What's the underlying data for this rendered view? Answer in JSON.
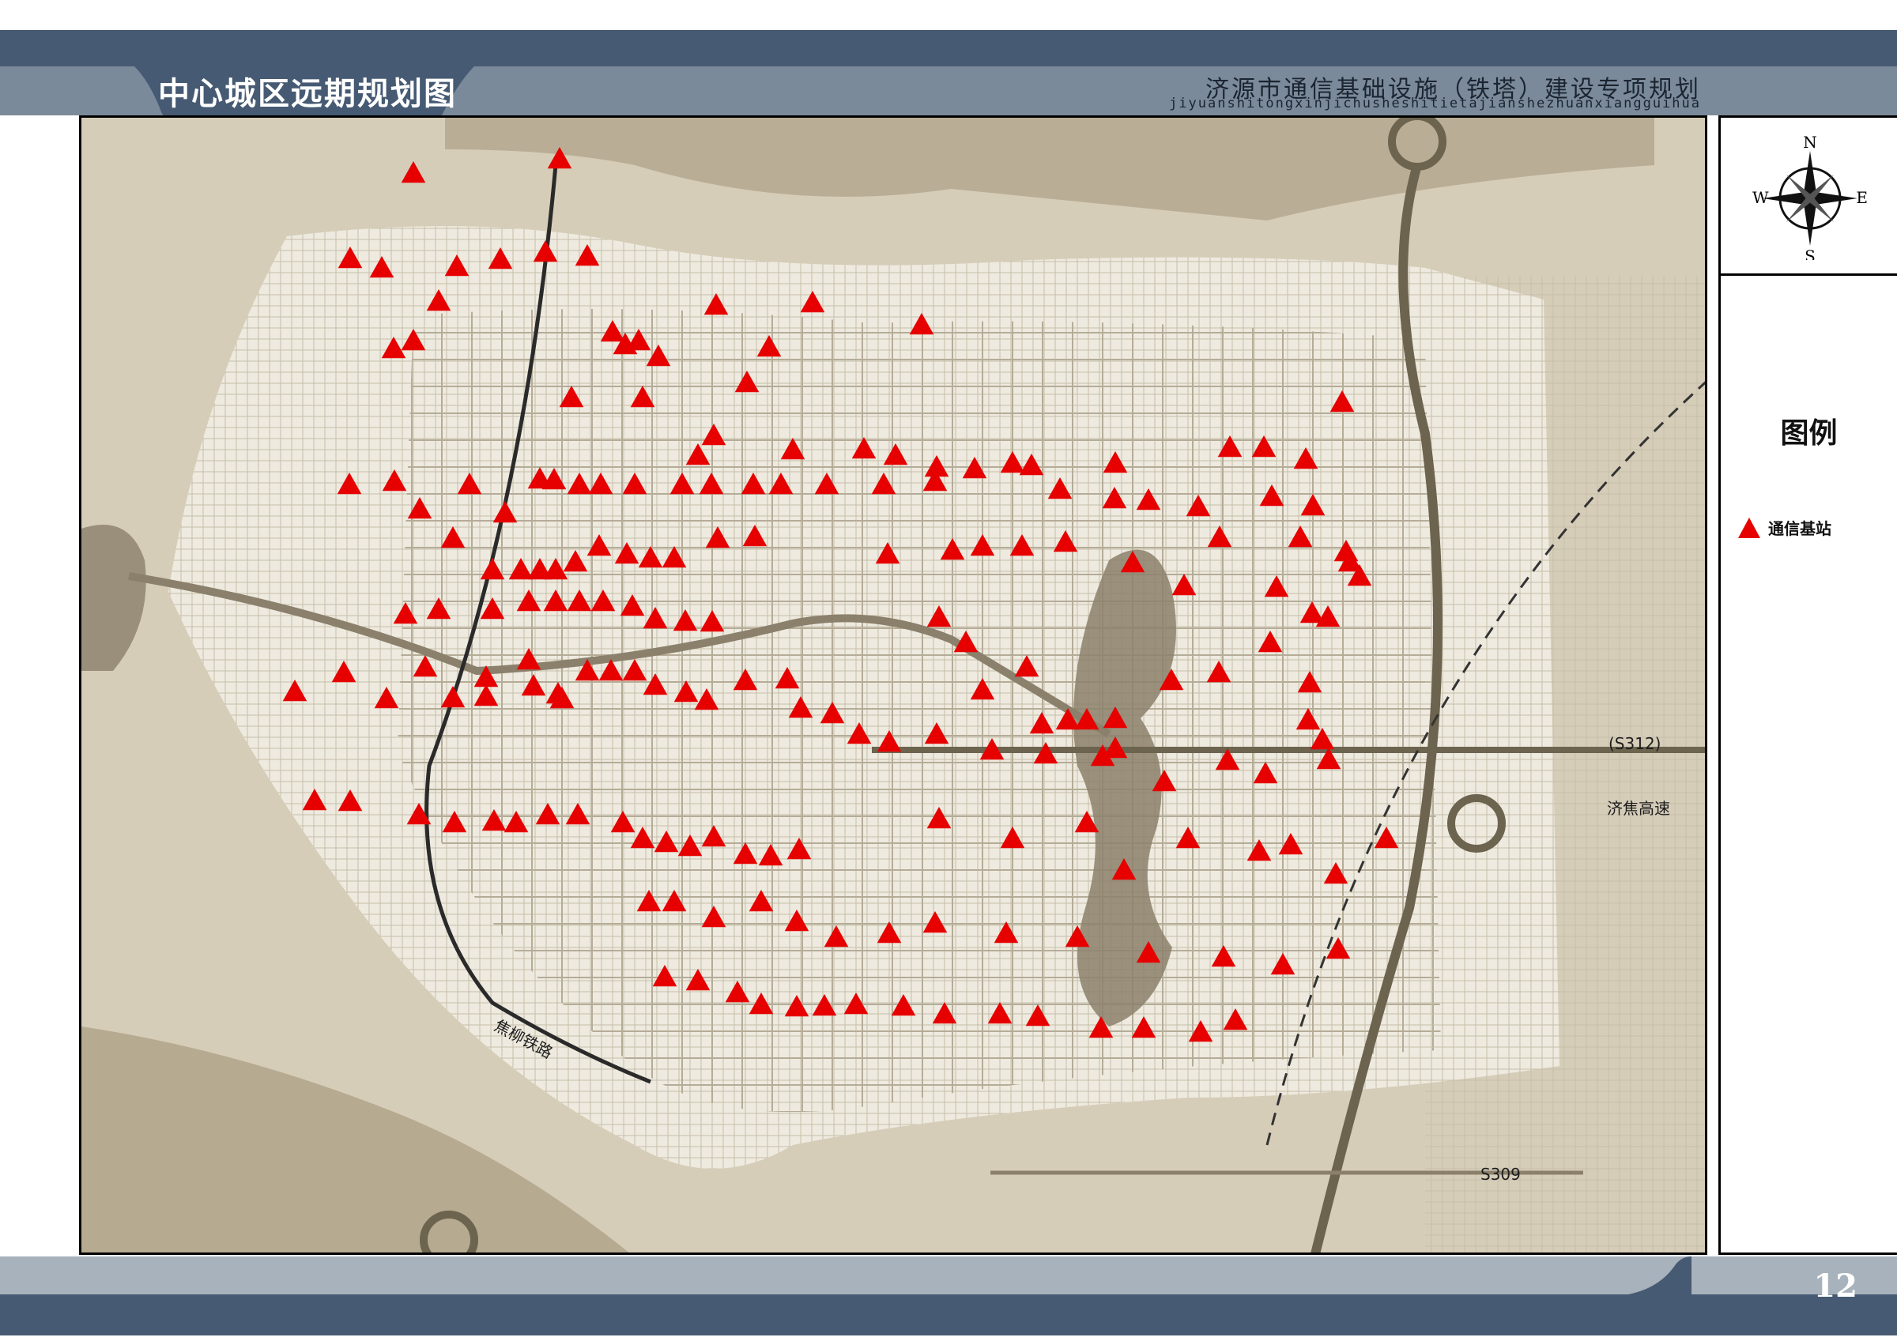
{
  "header": {
    "title": "中心城区远期规划图",
    "subtitle_cn": "济源市通信基础设施（铁塔）建设专项规划",
    "subtitle_pinyin": "jiyuanshitongxinjichusheshitietajianshezhuanxiangguihua"
  },
  "compass": {
    "n": "N",
    "s": "S",
    "e": "E",
    "w": "W"
  },
  "legend": {
    "title": "图例",
    "items": [
      {
        "label": "通信基站",
        "color": "#e60000",
        "icon": "red-triangle-icon"
      }
    ]
  },
  "map_labels": {
    "road_s312": "(S312)",
    "road_jijiao": "济焦高速",
    "road_s309": "S309",
    "rail_jiaoliu": "焦柳铁路"
  },
  "page_number": "12",
  "colors": {
    "header_dark": "#465a73",
    "header_light": "#7a8a9a",
    "marker": "#e60000",
    "water": "#8b806b"
  }
}
